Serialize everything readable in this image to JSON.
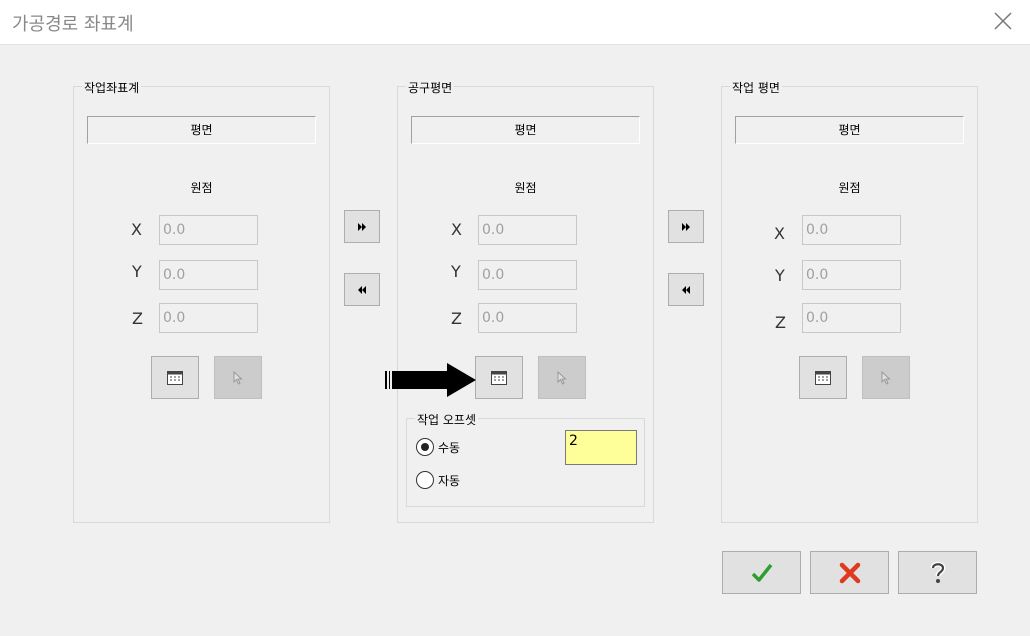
{
  "window": {
    "title": "가공경로 좌표계"
  },
  "panels": [
    {
      "label": "작업좌표계",
      "plane": "평면",
      "origin_label": "원점",
      "x": "0.0",
      "y": "0.0",
      "z": "0.0"
    },
    {
      "label": "공구평면",
      "plane": "평면",
      "origin_label": "원점",
      "x": "0.0",
      "y": "0.0",
      "z": "0.0"
    },
    {
      "label": "작업 평면",
      "plane": "평면",
      "origin_label": "원점",
      "x": "0.0",
      "y": "0.0",
      "z": "0.0"
    }
  ],
  "axes": {
    "x": "X",
    "y": "Y",
    "z": "Z"
  },
  "offset": {
    "label": "작업 오프셋",
    "manual_label": "수동",
    "auto_label": "자동",
    "selected": "manual",
    "value": "2"
  },
  "icons": {
    "close": "close-x-icon",
    "table": "table-icon",
    "cursor": "cursor-icon",
    "forward": "double-right-icon",
    "back": "double-left-icon",
    "ok": "green-check-icon",
    "cancel": "red-x-icon",
    "help": "question-icon"
  },
  "colors": {
    "offset_bg": "#ffff99",
    "ok": "#2e9e2e",
    "cancel": "#e03a1e"
  }
}
